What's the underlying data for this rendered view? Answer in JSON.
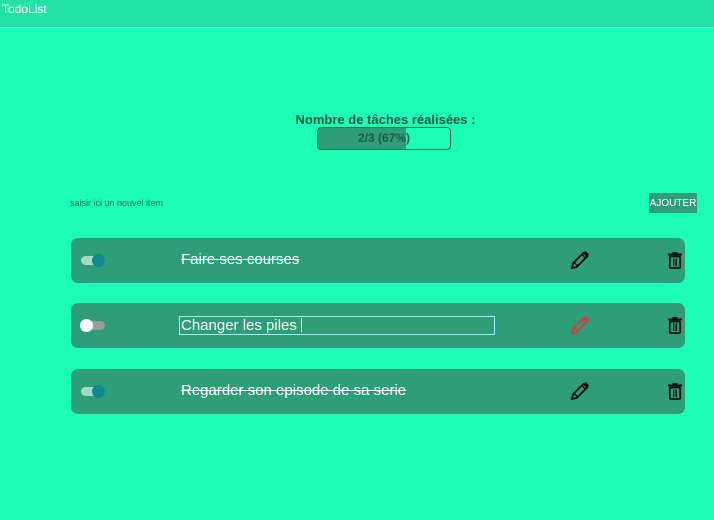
{
  "header": {
    "title": "TodoList"
  },
  "progress": {
    "title": "Nombre de tâches réalisées :",
    "text": "2/3 (67%)",
    "percent": 67
  },
  "new_item": {
    "placeholder": "saisir ici un nouvel item",
    "value": "",
    "add_label": "AJOUTER"
  },
  "colors": {
    "background": "#1cfdb6",
    "header": "#22e3a6",
    "card": "#2e9e78",
    "edit_active": "#d93a3a"
  },
  "todos": [
    {
      "label": "Faire ses courses",
      "done": true,
      "editing": false
    },
    {
      "label": "Changer les piles ",
      "done": false,
      "editing": true
    },
    {
      "label": "Regarder son episode de sa serie",
      "done": true,
      "editing": false
    }
  ]
}
